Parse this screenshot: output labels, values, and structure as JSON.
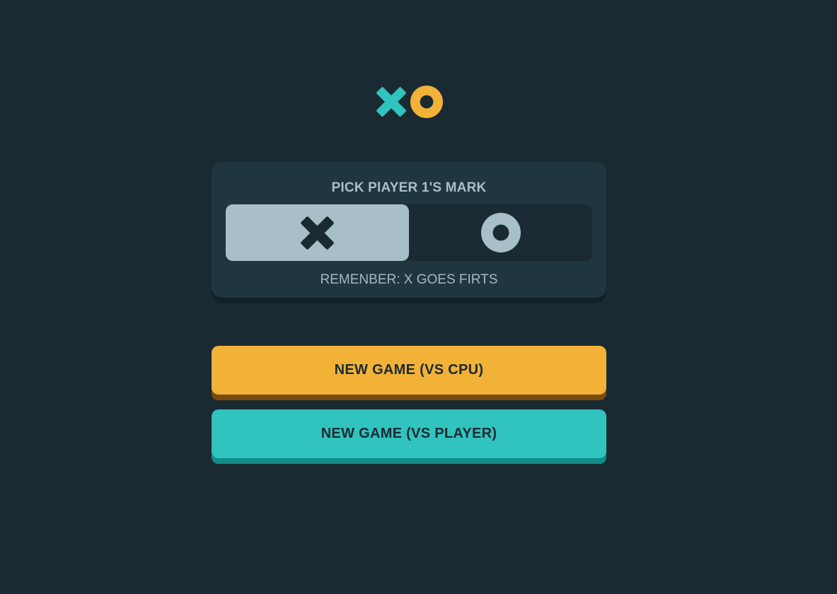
{
  "logo": {
    "x_icon": "x-mark-icon",
    "o_icon": "o-mark-icon",
    "x_color": "#31c3bd",
    "o_color": "#f2b137"
  },
  "menu": {
    "title": "PICK PlAYER 1'S MARK",
    "options": [
      {
        "mark": "X",
        "icon": "x-mark-icon",
        "selected": true
      },
      {
        "mark": "O",
        "icon": "o-mark-icon",
        "selected": false
      }
    ],
    "hint": "REMENBER: X GOES FIRTS"
  },
  "buttons": {
    "vs_cpu_label": "NEW GAME (VS CPU)",
    "vs_player_label": "NEW GAME (VS PLAYER)"
  },
  "colors": {
    "background": "#1a2a33",
    "card": "#1f3641",
    "silver": "#a8bfc9",
    "yellow": "#f2b137",
    "teal": "#31c3bd"
  }
}
